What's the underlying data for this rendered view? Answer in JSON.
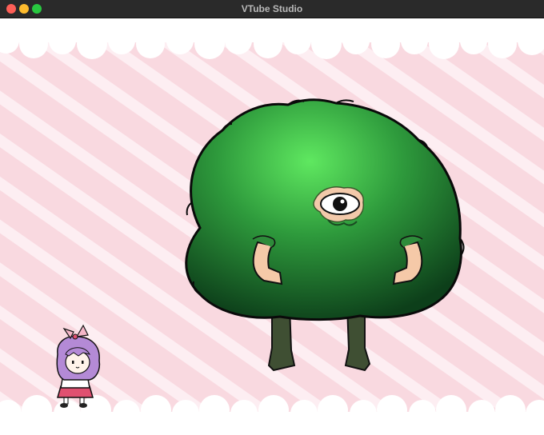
{
  "window": {
    "title": "VTube Studio",
    "traffic_lights": {
      "close": "#fe5f57",
      "minimize": "#febc2e",
      "maximize": "#28c840"
    }
  },
  "scene": {
    "background": {
      "base_color": "#f9d9e0",
      "stripe_color": "#fdeef2",
      "cloud_color": "#ffffff"
    },
    "characters": [
      {
        "name": "bush-monster",
        "fur_color": "#2e8b3a",
        "highlight_color": "#59e25c",
        "skin_color": "#f5c9a8"
      },
      {
        "name": "purple-hair-girl",
        "hair_color": "#b48ad6",
        "skirt_color": "#e05070"
      }
    ]
  }
}
